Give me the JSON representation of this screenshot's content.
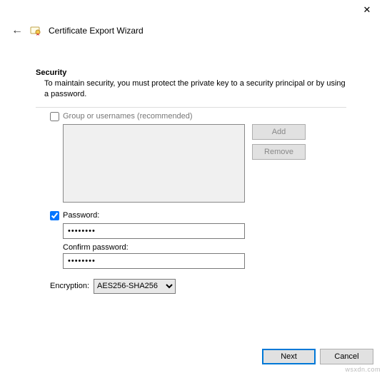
{
  "window": {
    "close_glyph": "✕"
  },
  "header": {
    "back_glyph": "←",
    "title": "Certificate Export Wizard"
  },
  "security": {
    "heading": "Security",
    "description": "To maintain security, you must protect the private key to a security principal or by using a password.",
    "group_checkbox_label": "Group or usernames (recommended)",
    "group_checked": false,
    "add_btn": "Add",
    "remove_btn": "Remove",
    "password_checkbox_label": "Password:",
    "password_checked": true,
    "password_value": "••••••••",
    "confirm_label": "Confirm password:",
    "confirm_value": "••••••••",
    "encryption_label": "Encryption:",
    "encryption_selected": "AES256-SHA256"
  },
  "footer": {
    "next": "Next",
    "cancel": "Cancel"
  },
  "watermark": "wsxdn.com"
}
